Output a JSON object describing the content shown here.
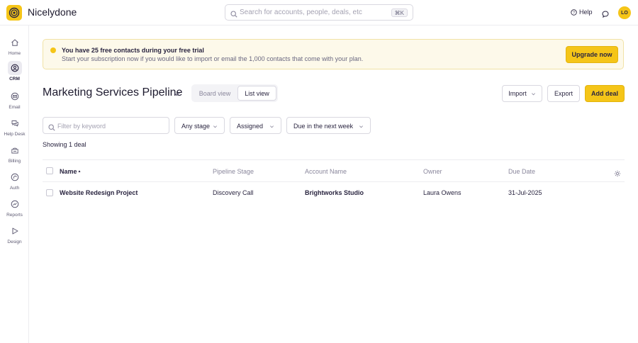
{
  "app": {
    "name": "Nicelydone",
    "avatar_initials": "LO",
    "accent": "#f5c518"
  },
  "search": {
    "placeholder": "Search for accounts, people, deals, etc",
    "shortcut": "⌘K"
  },
  "header": {
    "help_label": "Help"
  },
  "sidebar": {
    "items": [
      {
        "label": "Home",
        "icon": "home-icon",
        "active": false
      },
      {
        "label": "CRM",
        "icon": "crm-icon",
        "active": true
      },
      {
        "label": "Email",
        "icon": "email-icon",
        "active": false
      },
      {
        "label": "Help Desk",
        "icon": "helpdesk-icon",
        "active": false
      },
      {
        "label": "Billing",
        "icon": "billing-icon",
        "active": false
      },
      {
        "label": "Auth",
        "icon": "auth-icon",
        "active": false
      },
      {
        "label": "Reports",
        "icon": "reports-icon",
        "active": false
      },
      {
        "label": "Design",
        "icon": "design-icon",
        "active": false
      }
    ]
  },
  "banner": {
    "title": "You have 25 free contacts during your free trial",
    "message": "Start your subscription now if you would like to import or email the 1,000 contacts that come with your plan.",
    "cta": "Upgrade now"
  },
  "pipeline": {
    "title": "Marketing Services Pipeline",
    "views": [
      "Board view",
      "List view"
    ],
    "active_view": "List view",
    "actions": {
      "import": "Import",
      "export": "Export",
      "add": "Add deal"
    }
  },
  "filters": {
    "keyword_placeholder": "Filter by keyword",
    "stage": "Any stage",
    "assigned": "Assigned",
    "due": "Due in the next week"
  },
  "results": {
    "count_label": "Showing 1 deal"
  },
  "table": {
    "columns": [
      "Name",
      "Pipeline Stage",
      "Account Name",
      "Owner",
      "Due Date"
    ],
    "sort_indicator": "▲",
    "rows": [
      {
        "name": "Website Redesign Project",
        "stage": "Discovery Call",
        "account": "Brightworks Studio",
        "owner": "Laura Owens",
        "due": "31-Jul-2025"
      }
    ]
  }
}
